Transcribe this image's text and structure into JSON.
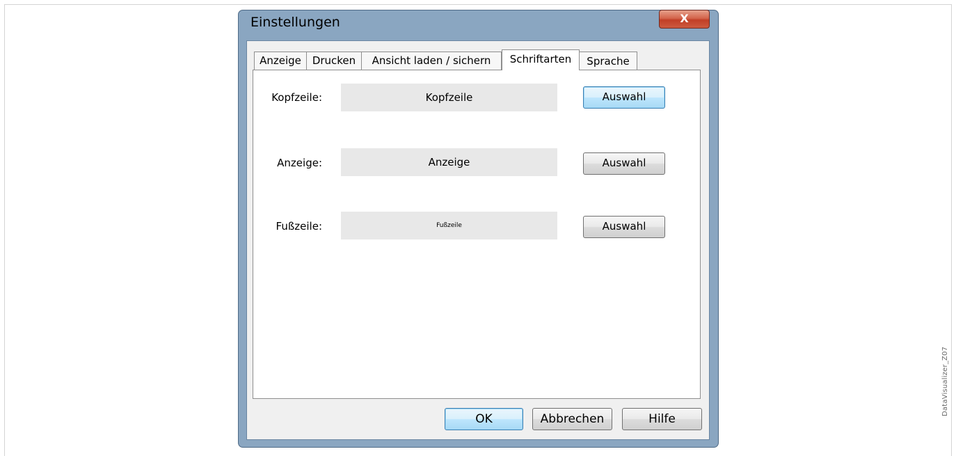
{
  "window": {
    "title": "Einstellungen",
    "close_label": "X"
  },
  "tabs": [
    {
      "label": "Anzeige"
    },
    {
      "label": "Drucken"
    },
    {
      "label": "Ansicht laden / sichern"
    },
    {
      "label": "Schriftarten",
      "active": true
    },
    {
      "label": "Sprache"
    }
  ],
  "rows": [
    {
      "label": "Kopfzeile:",
      "preview": "Kopfzeile",
      "button": "Auswahl"
    },
    {
      "label": "Anzeige:",
      "preview": "Anzeige",
      "button": "Auswahl"
    },
    {
      "label": "Fußzeile:",
      "preview": "Fußzeile",
      "button": "Auswahl"
    }
  ],
  "footer": {
    "ok": "OK",
    "cancel": "Abbrechen",
    "help": "Hilfe"
  },
  "watermark": "DataVisualizer_Z07",
  "colors": {
    "titlebar": "#8aa6c1",
    "close": "#c13f27",
    "focus": "#3c7fb1"
  }
}
